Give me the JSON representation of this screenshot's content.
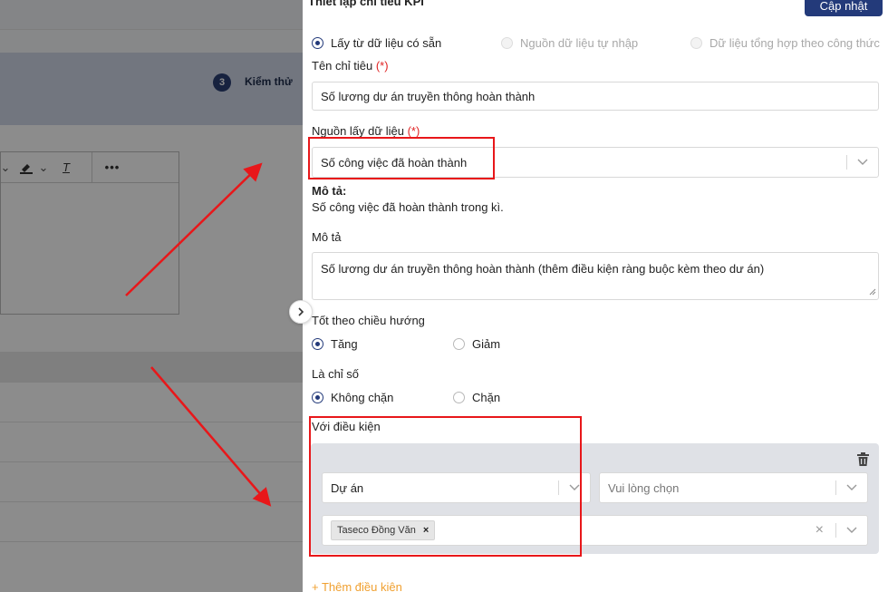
{
  "background": {
    "step": {
      "number": "3",
      "label": "Kiểm thử"
    }
  },
  "panel": {
    "title": "Thiết lập chỉ tiêu KPI",
    "update_button": "Cập nhật",
    "source_options": [
      {
        "label": "Lấy từ dữ liệu có sẵn",
        "selected": true,
        "disabled": false
      },
      {
        "label": "Nguồn dữ liệu tự nhập",
        "selected": false,
        "disabled": true
      },
      {
        "label": "Dữ liệu tổng hợp theo công thức",
        "selected": false,
        "disabled": true
      }
    ],
    "name_field": {
      "label": "Tên chỉ tiêu",
      "required_mark": "(*)",
      "value": "Số lương dư án truyền thông hoàn thành"
    },
    "data_source": {
      "label": "Nguồn lấy dữ liệu",
      "required_mark": "(*)",
      "value": "Số công việc đã hoàn thành"
    },
    "description_static": {
      "label": "Mô tả:",
      "text": "Số công việc đã hoàn thành trong kì."
    },
    "description_field": {
      "label": "Mô tả",
      "value": "Số lương dư án truyền thông hoàn thành (thêm điều kiện ràng buộc kèm theo dư án)"
    },
    "direction": {
      "label": "Tốt theo chiều hướng",
      "options": [
        {
          "label": "Tăng",
          "selected": true
        },
        {
          "label": "Giảm",
          "selected": false
        }
      ]
    },
    "blocking": {
      "label": "Là chỉ số",
      "options": [
        {
          "label": "Không chặn",
          "selected": true
        },
        {
          "label": "Chặn",
          "selected": false
        }
      ]
    },
    "conditions": {
      "label": "Với điều kiện",
      "field_select": "Dự án",
      "value_select_placeholder": "Vui lòng chọn",
      "tags": [
        "Taseco Đồng Văn"
      ],
      "add_label": "+ Thêm điều kiện"
    }
  },
  "colors": {
    "primary": "#233a7a",
    "required": "#e02424",
    "annotation": "#e8171a",
    "add_link": "#f0a030"
  }
}
